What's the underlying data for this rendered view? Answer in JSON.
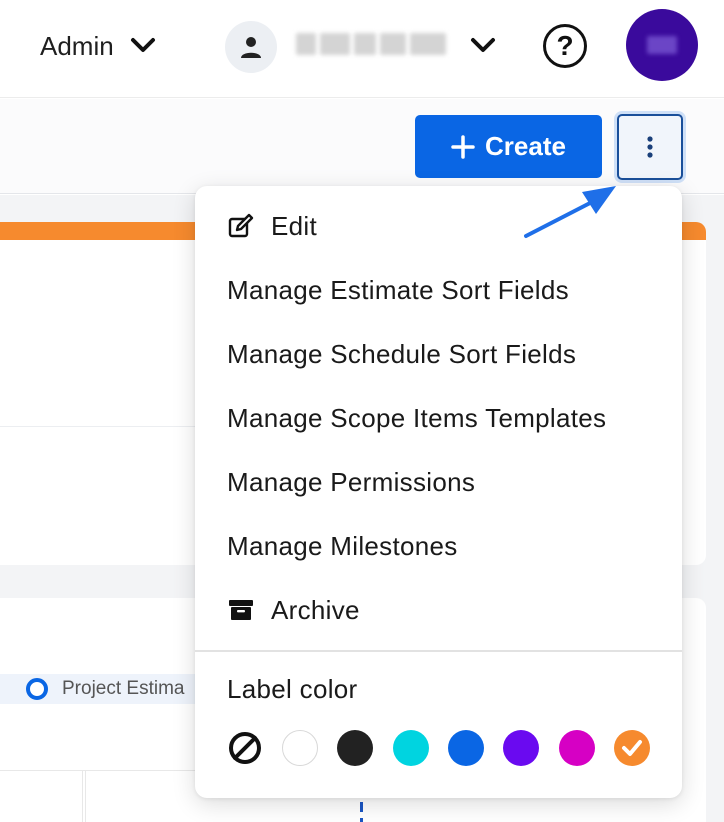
{
  "header": {
    "role_label": "Admin",
    "help_label": "?"
  },
  "toolbar": {
    "create_label": "Create",
    "create_icon": "plus-icon",
    "more_icon": "vertical-dots-icon"
  },
  "background": {
    "legend_label": "Project Estima"
  },
  "menu": {
    "items": [
      {
        "label": "Edit",
        "icon": "edit-icon"
      },
      {
        "label": "Manage Estimate Sort Fields"
      },
      {
        "label": "Manage Schedule Sort Fields"
      },
      {
        "label": "Manage Scope Items Templates"
      },
      {
        "label": "Manage Permissions"
      },
      {
        "label": "Manage Milestones"
      },
      {
        "label": "Archive",
        "icon": "archive-icon"
      }
    ],
    "label_color_title": "Label color",
    "swatches": [
      {
        "name": "none",
        "color": "none"
      },
      {
        "name": "white",
        "color": "#ffffff"
      },
      {
        "name": "black",
        "color": "#222222"
      },
      {
        "name": "cyan",
        "color": "#00d4e0"
      },
      {
        "name": "blue",
        "color": "#0a66e4"
      },
      {
        "name": "purple",
        "color": "#6a0af0"
      },
      {
        "name": "magenta",
        "color": "#d600c4"
      },
      {
        "name": "orange",
        "color": "#f68a2e",
        "selected": true
      }
    ]
  },
  "colors": {
    "primary": "#0a66e4",
    "accent_orange": "#f68a2e",
    "org_avatar": "#3a0a9c"
  }
}
